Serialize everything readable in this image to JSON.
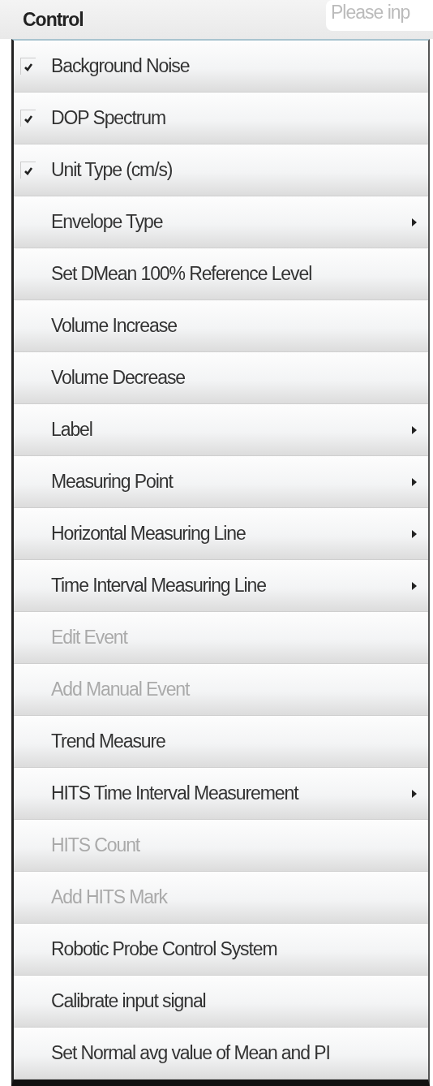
{
  "header": {
    "title": "Control",
    "search": {
      "placeholder": "Please inp"
    }
  },
  "menu": {
    "items": [
      {
        "label": "Background Noise",
        "kind": "check",
        "checked": true,
        "disabled": false
      },
      {
        "label": "DOP Spectrum",
        "kind": "check",
        "checked": true,
        "disabled": false
      },
      {
        "label": "Unit Type (cm/s)",
        "kind": "check",
        "checked": true,
        "disabled": false
      },
      {
        "label": "Envelope Type",
        "kind": "submenu",
        "disabled": false
      },
      {
        "label": "Set DMean 100% Reference Level",
        "kind": "action",
        "disabled": false
      },
      {
        "label": "Volume Increase",
        "kind": "action",
        "disabled": false
      },
      {
        "label": "Volume Decrease",
        "kind": "action",
        "disabled": false
      },
      {
        "label": "Label",
        "kind": "submenu",
        "disabled": false
      },
      {
        "label": "Measuring Point",
        "kind": "submenu",
        "disabled": false
      },
      {
        "label": "Horizontal Measuring Line",
        "kind": "submenu",
        "disabled": false
      },
      {
        "label": "Time Interval Measuring Line",
        "kind": "submenu",
        "disabled": false
      },
      {
        "label": "Edit Event",
        "kind": "action",
        "disabled": true
      },
      {
        "label": "Add Manual Event",
        "kind": "action",
        "disabled": true
      },
      {
        "label": "Trend Measure",
        "kind": "action",
        "disabled": false
      },
      {
        "label": "HITS Time Interval Measurement",
        "kind": "submenu",
        "disabled": false
      },
      {
        "label": "HITS Count",
        "kind": "action",
        "disabled": true
      },
      {
        "label": "Add HITS Mark",
        "kind": "action",
        "disabled": true
      },
      {
        "label": "Robotic Probe Control System",
        "kind": "action",
        "disabled": false
      },
      {
        "label": "Calibrate input signal",
        "kind": "action",
        "disabled": false
      },
      {
        "label": "Set Normal avg value of Mean and PI",
        "kind": "action",
        "disabled": false
      }
    ]
  }
}
